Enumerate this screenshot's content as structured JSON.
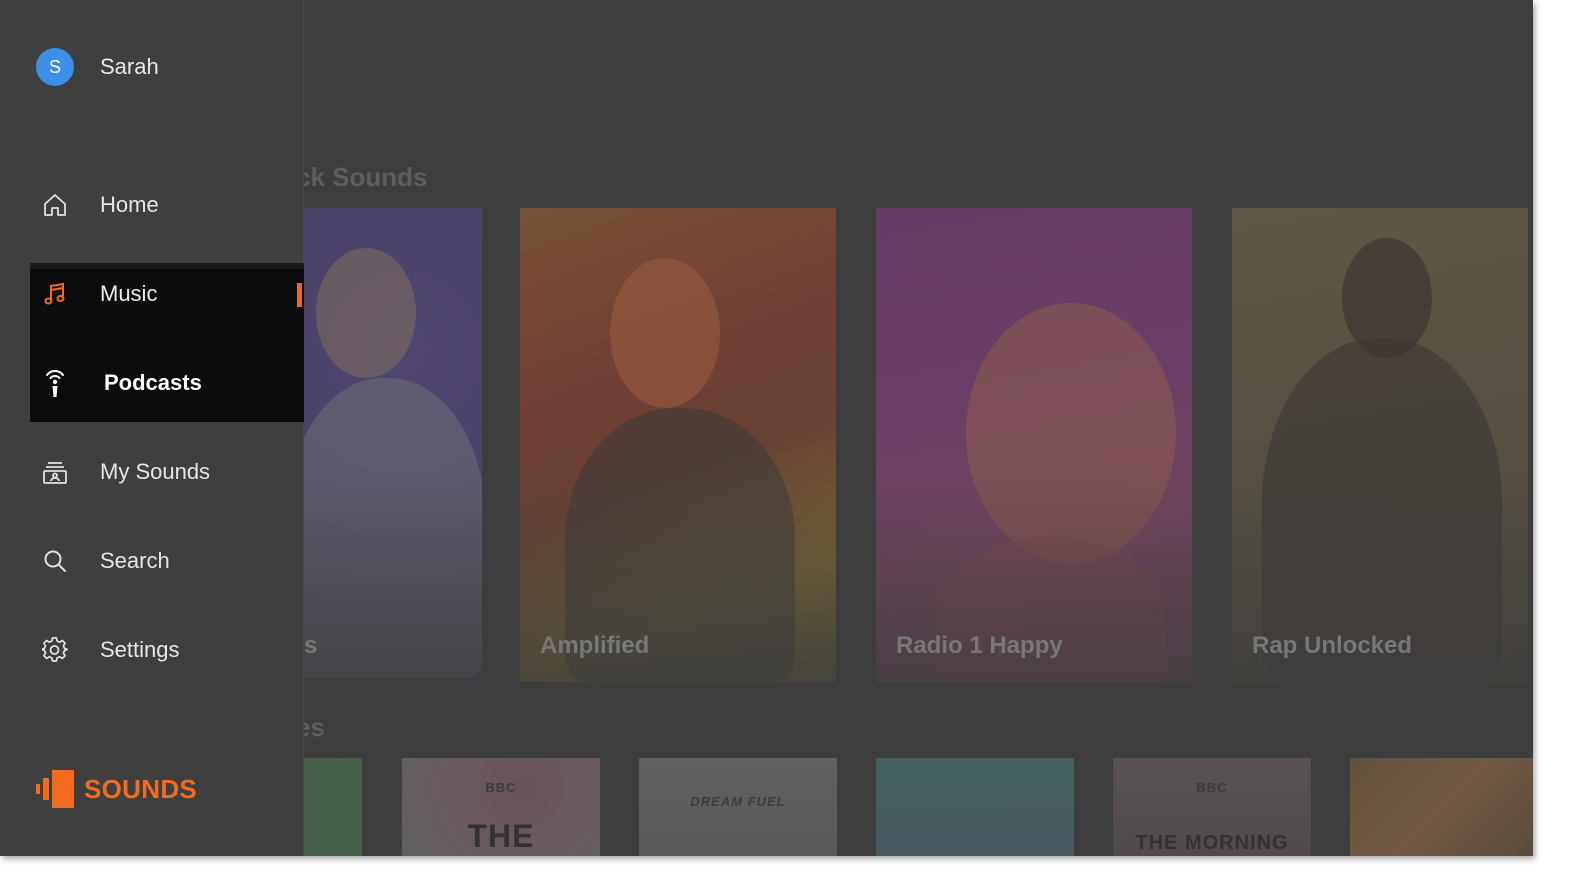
{
  "profile": {
    "initial": "S",
    "name": "Sarah"
  },
  "nav": {
    "home": "Home",
    "music": "Music",
    "podcasts": "Podcasts",
    "my_sounds": "My Sounds",
    "search": "Search",
    "settings": "Settings"
  },
  "brand": {
    "text": "SOUNDS"
  },
  "main": {
    "section1_title": "ck Sounds",
    "section2_title": "es",
    "cards": [
      {
        "label": "s"
      },
      {
        "label": "Amplified"
      },
      {
        "label": "Radio 1 Happy"
      },
      {
        "label": "Rap Unlocked"
      }
    ],
    "tiles": [
      {
        "text": "",
        "big": ""
      },
      {
        "text": "BBC",
        "big": "THE"
      },
      {
        "text": "DREAM FUEL",
        "big": ""
      },
      {
        "text": "",
        "big": ""
      },
      {
        "text": "BBC",
        "big": "THE MORNING"
      },
      {
        "text": "",
        "big": ""
      }
    ]
  },
  "colors": {
    "accent": "#f26b21",
    "avatar": "#3d8ee8",
    "focus_bg": "#0c0c0c",
    "drawer_bg": "#3f3f3f"
  },
  "icons": [
    "home-icon",
    "music-note-icon",
    "podcast-mic-icon",
    "my-sounds-icon",
    "search-icon",
    "gear-icon",
    "sounds-logo-icon"
  ]
}
